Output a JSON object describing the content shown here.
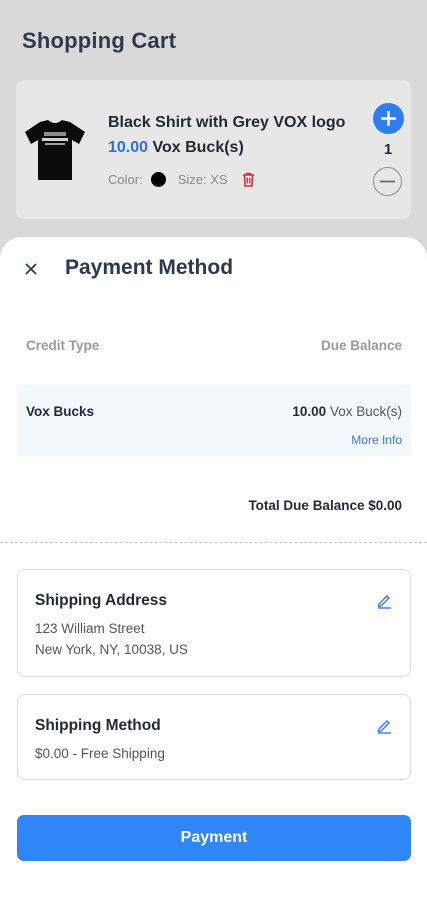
{
  "page": {
    "title": "Shopping Cart"
  },
  "cart_item": {
    "name": "Black Shirt with Grey VOX logo",
    "price_amount": "10.00",
    "price_unit": "Vox Buck(s)",
    "color_label": "Color:",
    "color_value": "#000000",
    "size_label": "Size: XS",
    "quantity": "1"
  },
  "payment_sheet": {
    "title": "Payment Method",
    "col_credit_type": "Credit Type",
    "col_due_balance": "Due Balance",
    "credit_name": "Vox Bucks",
    "credit_amount": "10.00",
    "credit_unit": "Vox Buck(s)",
    "more_info": "More Info",
    "total_due": "Total Due Balance $0.00"
  },
  "shipping_address": {
    "title": "Shipping Address",
    "line1": "123 William Street",
    "line2": "New York, NY, 10038, US"
  },
  "shipping_method": {
    "title": "Shipping Method",
    "line1": "$0.00 - Free Shipping"
  },
  "payment_button": {
    "label": "Payment"
  },
  "colors": {
    "accent": "#2f86f6",
    "link": "#3a7be0",
    "delete": "#d93030"
  }
}
